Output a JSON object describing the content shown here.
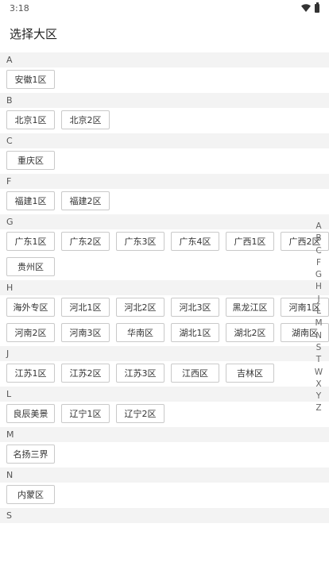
{
  "status": {
    "time": "3:18"
  },
  "header": {
    "title": "选择大区"
  },
  "groups": [
    {
      "letter": "A",
      "items": [
        "安徽1区"
      ]
    },
    {
      "letter": "B",
      "items": [
        "北京1区",
        "北京2区"
      ]
    },
    {
      "letter": "C",
      "items": [
        "重庆区"
      ]
    },
    {
      "letter": "F",
      "items": [
        "福建1区",
        "福建2区"
      ]
    },
    {
      "letter": "G",
      "items": [
        "广东1区",
        "广东2区",
        "广东3区",
        "广东4区",
        "广西1区",
        "广西2区",
        "贵州区"
      ]
    },
    {
      "letter": "H",
      "items": [
        "海外专区",
        "河北1区",
        "河北2区",
        "河北3区",
        "黑龙江区",
        "河南1区",
        "河南2区",
        "河南3区",
        "华南区",
        "湖北1区",
        "湖北2区",
        "湖南区"
      ]
    },
    {
      "letter": "J",
      "items": [
        "江苏1区",
        "江苏2区",
        "江苏3区",
        "江西区",
        "吉林区"
      ]
    },
    {
      "letter": "L",
      "items": [
        "良辰美景",
        "辽宁1区",
        "辽宁2区"
      ]
    },
    {
      "letter": "M",
      "items": [
        "名扬三界"
      ]
    },
    {
      "letter": "N",
      "items": [
        "内蒙区"
      ]
    },
    {
      "letter": "S",
      "items": []
    }
  ],
  "index_letters": [
    "A",
    "B",
    "C",
    "F",
    "G",
    "H",
    "J",
    "L",
    "M",
    "N",
    "S",
    "T",
    "W",
    "X",
    "Y",
    "Z"
  ]
}
